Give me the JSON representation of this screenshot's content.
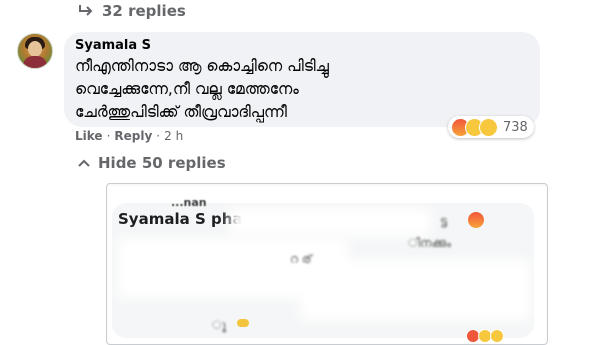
{
  "replies_top": {
    "label": "32 replies"
  },
  "comment": {
    "author": "Syamala S",
    "lines": [
      "നീഎന്തിനാടാ ആ കൊച്ചിനെ പിടിച്ചു",
      "വെച്ചേക്കുന്നേ,നീ വല്ല മേത്തനേം",
      "ചേർത്തുപിടിക്ക് തീവ്രവാദിപ്പന്നീ"
    ],
    "actions": {
      "like": "Like",
      "reply": "Reply",
      "sep": "·",
      "time": "2 h"
    },
    "reactions": {
      "icons": [
        "angry-reaction",
        "haha-reaction",
        "sad-reaction"
      ],
      "count": "738"
    }
  },
  "hide_replies": {
    "label": "Hide 50 replies"
  },
  "embedded_screenshot": {
    "name_fragment": "...nan",
    "text_fragment": "Syamala S pha",
    "fragments": [
      "ട്ട",
      "ിനക്കും",
      "റ ര്",
      "ു"
    ]
  },
  "colors": {
    "bubble": "#f0f2f5",
    "secondary_text": "#65676b",
    "angry": "#f0563b",
    "haha": "#f7c73e"
  }
}
